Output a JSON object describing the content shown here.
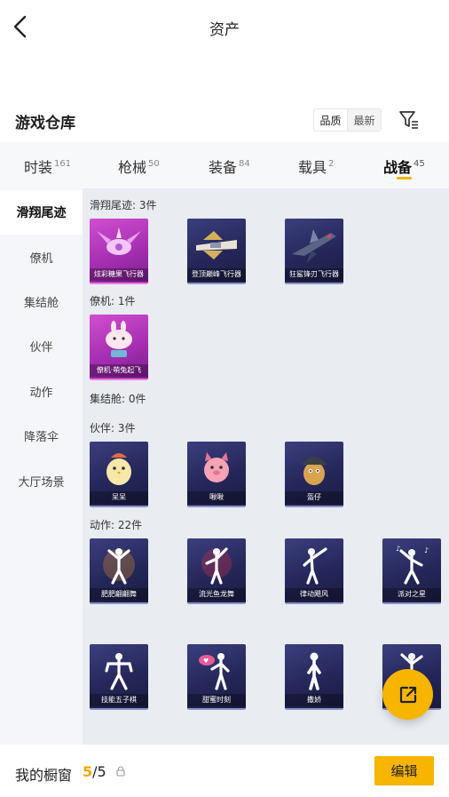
{
  "header": {
    "title": "资产"
  },
  "section": {
    "title": "游戏仓库",
    "sort_quality": "品质",
    "sort_latest": "最新"
  },
  "tabs": [
    {
      "label": "时装",
      "count": "161"
    },
    {
      "label": "枪械",
      "count": "50"
    },
    {
      "label": "装备",
      "count": "84"
    },
    {
      "label": "载具",
      "count": "2"
    },
    {
      "label": "战备",
      "count": "45"
    }
  ],
  "sidebar": {
    "items": [
      "滑翔尾迹",
      "僚机",
      "集结舱",
      "伙伴",
      "动作",
      "降落伞",
      "大厅场景"
    ]
  },
  "groups": {
    "glide": {
      "label": "滑翔尾迹: 3件",
      "items": [
        "炫彩糖果飞行器",
        "登顶巅峰飞行器",
        "狂鲨锋刃飞行器"
      ]
    },
    "wingman": {
      "label": "僚机: 1件",
      "items": [
        "僚机·萌兔起飞"
      ]
    },
    "pod": {
      "label": "集结舱: 0件"
    },
    "partner": {
      "label": "伙伴: 3件",
      "items": [
        "呆呆",
        "啾啾",
        "盔仔"
      ]
    },
    "action": {
      "label": "动作: 22件",
      "items": [
        "肥肥翩翩舞",
        "流光鱼龙舞",
        "律动飓风",
        "派对之星",
        "技能五子棋",
        "甜蜜时刻",
        "撒娇"
      ]
    }
  },
  "bottom": {
    "label": "我的橱窗",
    "count_used": "5",
    "count_total": "/5",
    "edit": "编辑"
  },
  "colors": {
    "accent": "#f7b500",
    "card_pink": "#b236be",
    "card_navy": "#2a2c62"
  }
}
